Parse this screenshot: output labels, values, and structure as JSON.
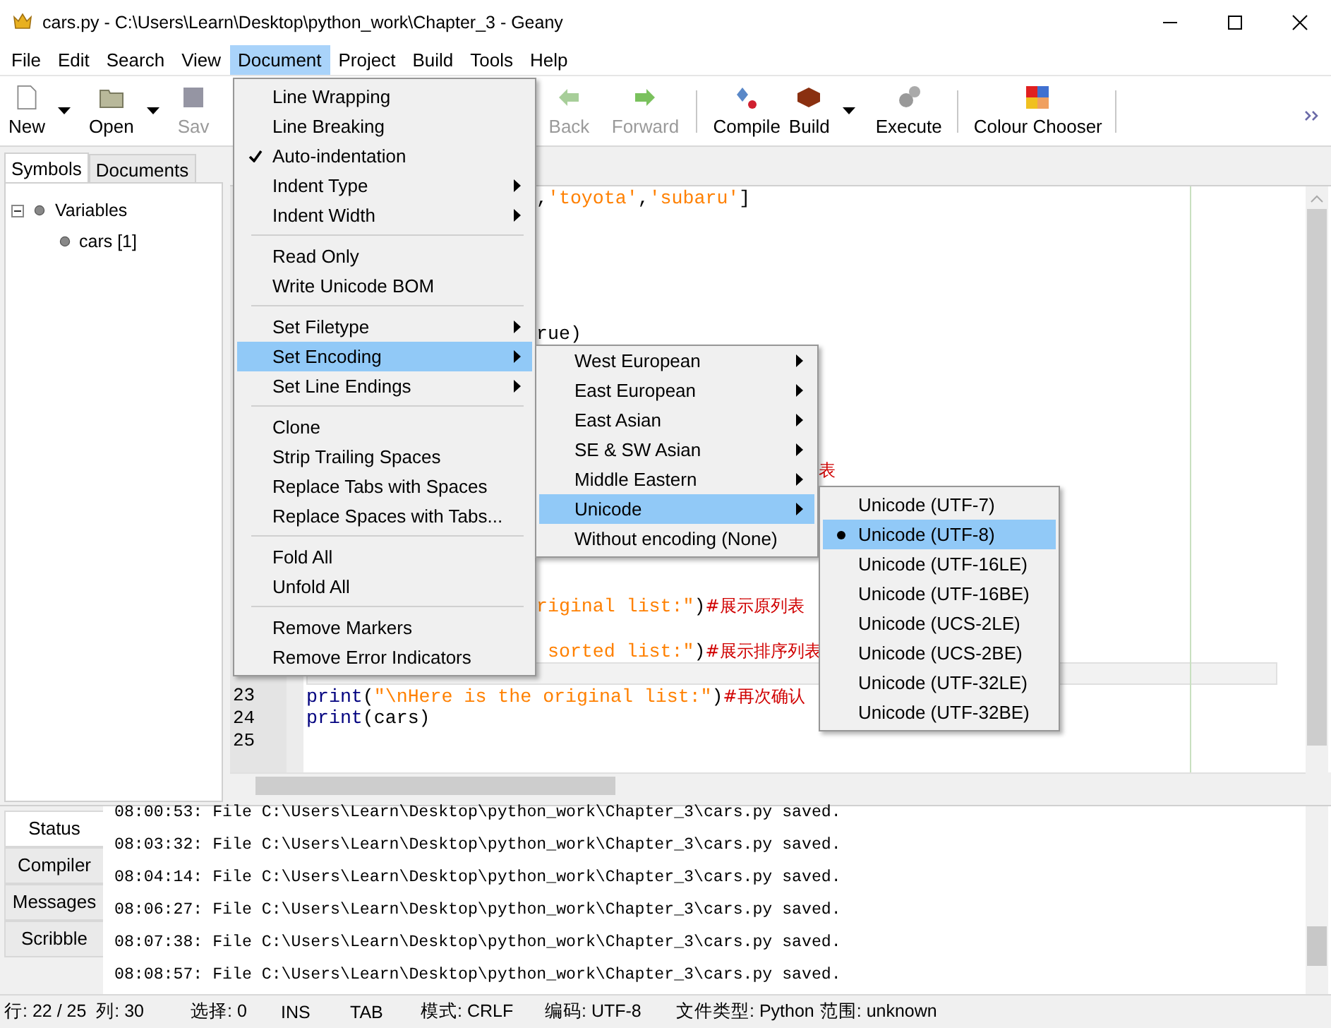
{
  "window": {
    "title": "cars.py - C:\\Users\\Learn\\Desktop\\python_work\\Chapter_3 - Geany"
  },
  "menubar": [
    {
      "label": "File",
      "selected": false
    },
    {
      "label": "Edit",
      "selected": false
    },
    {
      "label": "Search",
      "selected": false
    },
    {
      "label": "View",
      "selected": false
    },
    {
      "label": "Document",
      "selected": true
    },
    {
      "label": "Project",
      "selected": false
    },
    {
      "label": "Build",
      "selected": false
    },
    {
      "label": "Tools",
      "selected": false
    },
    {
      "label": "Help",
      "selected": false
    }
  ],
  "toolbar": [
    {
      "kind": "button",
      "label": "New",
      "disabled": false,
      "dropdown": true
    },
    {
      "kind": "button",
      "label": "Open",
      "disabled": false,
      "dropdown": true
    },
    {
      "kind": "button",
      "label": "Sav",
      "disabled": true
    },
    {
      "kind": "gap"
    },
    {
      "kind": "button",
      "label": "Back",
      "disabled": true
    },
    {
      "kind": "button",
      "label": "Forward",
      "disabled": true
    },
    {
      "kind": "separator"
    },
    {
      "kind": "button",
      "label": "Compile",
      "disabled": false
    },
    {
      "kind": "button",
      "label": "Build",
      "disabled": false,
      "dropdown": true
    },
    {
      "kind": "button",
      "label": "Execute",
      "disabled": false
    },
    {
      "kind": "separator"
    },
    {
      "kind": "button",
      "label": "Colour Chooser",
      "disabled": false
    },
    {
      "kind": "separator"
    }
  ],
  "sidebar": {
    "tabs": [
      {
        "label": "Symbols",
        "selected": true
      },
      {
        "label": "Documents",
        "selected": false
      }
    ],
    "tree": [
      {
        "label": "Variables",
        "expanded": true,
        "children": [
          {
            "label": "cars [1]"
          }
        ]
      }
    ]
  },
  "editor": {
    "lines": [
      {
        "segments": [
          {
            "kind": "op",
            "text": ","
          },
          {
            "kind": "string",
            "text": "'toyota'"
          },
          {
            "kind": "op",
            "text": ","
          },
          {
            "kind": "string",
            "text": "'subaru'"
          },
          {
            "kind": "op",
            "text": "]"
          }
        ]
      },
      {
        "segments": [
          {
            "kind": "op",
            "text": "rue)"
          }
        ]
      },
      {
        "segments": [
          {
            "kind": "comment",
            "text": "表"
          }
        ]
      },
      {
        "segments": [
          {
            "kind": "string",
            "text": "riginal list:\""
          },
          {
            "kind": "op",
            "text": ")"
          },
          {
            "kind": "comment",
            "text": "#展示原列表"
          }
        ]
      },
      {
        "segments": [
          {
            "kind": "string",
            "text": " sorted list:\""
          },
          {
            "kind": "op",
            "text": ")"
          },
          {
            "kind": "comment",
            "text": "#展示排序列表"
          }
        ]
      },
      {
        "current": true
      },
      {
        "number": "23",
        "current": false,
        "segments": [
          {
            "kind": "keyword",
            "text": "print"
          },
          {
            "kind": "op",
            "text": "("
          },
          {
            "kind": "string",
            "text": "\"\\nHere is the original list:\""
          },
          {
            "kind": "op",
            "text": ")"
          },
          {
            "kind": "comment",
            "text": "#再次确认"
          }
        ]
      },
      {
        "number": "24",
        "current": false,
        "segments": [
          {
            "kind": "keyword",
            "text": "print"
          },
          {
            "kind": "op",
            "text": "(cars)"
          }
        ]
      },
      {
        "number": "25",
        "current": false
      }
    ]
  },
  "document_menu": [
    {
      "kind": "item",
      "label": "Line Wrapping",
      "selected": false
    },
    {
      "kind": "item",
      "label": "Line Breaking",
      "selected": false
    },
    {
      "kind": "item",
      "label": "Auto-indentation",
      "checked": true,
      "selected": false
    },
    {
      "kind": "item",
      "label": "Indent Type",
      "submenu": true,
      "selected": false
    },
    {
      "kind": "item",
      "label": "Indent Width",
      "submenu": true,
      "selected": false
    },
    {
      "kind": "separator"
    },
    {
      "kind": "item",
      "label": "Read Only",
      "selected": false
    },
    {
      "kind": "item",
      "label": "Write Unicode BOM",
      "selected": false
    },
    {
      "kind": "separator"
    },
    {
      "kind": "item",
      "label": "Set Filetype",
      "submenu": true,
      "selected": false
    },
    {
      "kind": "item",
      "label": "Set Encoding",
      "submenu": true,
      "selected": true
    },
    {
      "kind": "item",
      "label": "Set Line Endings",
      "submenu": true,
      "selected": false
    },
    {
      "kind": "separator"
    },
    {
      "kind": "item",
      "label": "Clone",
      "selected": false
    },
    {
      "kind": "item",
      "label": "Strip Trailing Spaces",
      "selected": false
    },
    {
      "kind": "item",
      "label": "Replace Tabs with Spaces",
      "selected": false
    },
    {
      "kind": "item",
      "label": "Replace Spaces with Tabs...",
      "selected": false
    },
    {
      "kind": "separator"
    },
    {
      "kind": "item",
      "label": "Fold All",
      "selected": false
    },
    {
      "kind": "item",
      "label": "Unfold All",
      "selected": false
    },
    {
      "kind": "separator"
    },
    {
      "kind": "item",
      "label": "Remove Markers",
      "selected": false
    },
    {
      "kind": "item",
      "label": "Remove Error Indicators",
      "selected": false
    }
  ],
  "encoding_menu": [
    {
      "kind": "item",
      "label": "West European",
      "submenu": true,
      "selected": false
    },
    {
      "kind": "item",
      "label": "East European",
      "submenu": true,
      "selected": false
    },
    {
      "kind": "item",
      "label": "East Asian",
      "submenu": true,
      "selected": false
    },
    {
      "kind": "item",
      "label": "SE & SW Asian",
      "submenu": true,
      "selected": false
    },
    {
      "kind": "item",
      "label": "Middle Eastern",
      "submenu": true,
      "selected": false
    },
    {
      "kind": "item",
      "label": "Unicode",
      "submenu": true,
      "selected": true
    },
    {
      "kind": "item",
      "label": "Without encoding (None)",
      "selected": false
    }
  ],
  "unicode_menu": [
    {
      "label": "Unicode (UTF-7)",
      "selected": false
    },
    {
      "label": "Unicode (UTF-8)",
      "checked": true,
      "selected": true
    },
    {
      "label": "Unicode (UTF-16LE)",
      "selected": false
    },
    {
      "label": "Unicode (UTF-16BE)",
      "selected": false
    },
    {
      "label": "Unicode (UCS-2LE)",
      "selected": false
    },
    {
      "label": "Unicode (UCS-2BE)",
      "selected": false
    },
    {
      "label": "Unicode (UTF-32LE)",
      "selected": false
    },
    {
      "label": "Unicode (UTF-32BE)",
      "selected": false
    }
  ],
  "message_panel": {
    "tabs": [
      {
        "label": "Status",
        "selected": true
      },
      {
        "label": "Compiler",
        "selected": false
      },
      {
        "label": "Messages",
        "selected": false
      },
      {
        "label": "Scribble",
        "selected": false
      }
    ],
    "log": [
      "08:00:53: File C:\\Users\\Learn\\Desktop\\python_work\\Chapter_3\\cars.py saved.",
      "08:03:32: File C:\\Users\\Learn\\Desktop\\python_work\\Chapter_3\\cars.py saved.",
      "08:04:14: File C:\\Users\\Learn\\Desktop\\python_work\\Chapter_3\\cars.py saved.",
      "08:06:27: File C:\\Users\\Learn\\Desktop\\python_work\\Chapter_3\\cars.py saved.",
      "08:07:38: File C:\\Users\\Learn\\Desktop\\python_work\\Chapter_3\\cars.py saved.",
      "08:08:57: File C:\\Users\\Learn\\Desktop\\python_work\\Chapter_3\\cars.py saved."
    ]
  },
  "status_bar": [
    "行: 22 / 25  列: 30",
    "选择: 0",
    "INS",
    "TAB",
    "模式: CRLF",
    "编码: UTF-8",
    "文件类型: Python",
    "范围: unknown"
  ]
}
